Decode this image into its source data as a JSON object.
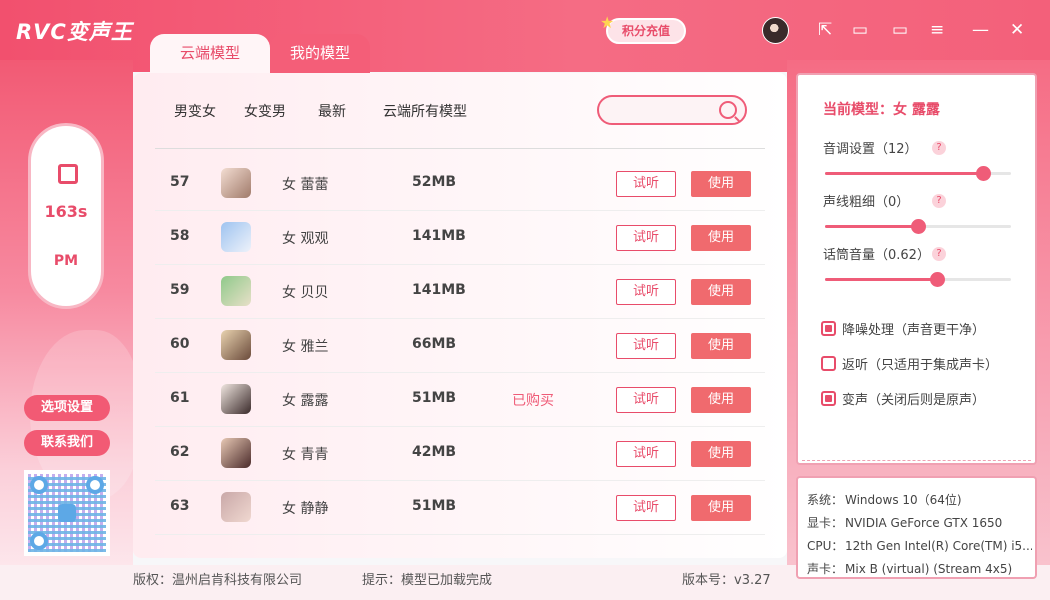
{
  "app": {
    "logo": "RVC变声王",
    "recharge": "积分充值"
  },
  "window_controls": {
    "edit": "⇱",
    "screen": "▭",
    "chat": "▭",
    "menu": "≡",
    "min": "—",
    "close": "✕"
  },
  "tabs": [
    "云端模型",
    "我的模型"
  ],
  "categories": [
    "男变女",
    "女变男",
    "最新",
    "云端所有模型"
  ],
  "search": {
    "placeholder": "",
    "value": ""
  },
  "models": [
    {
      "num": "57",
      "name": "女 蕾蕾",
      "size": "52MB",
      "status": "",
      "try": "试听",
      "use": "使用"
    },
    {
      "num": "58",
      "name": "女 观观",
      "size": "141MB",
      "status": "",
      "try": "试听",
      "use": "使用"
    },
    {
      "num": "59",
      "name": "女 贝贝",
      "size": "141MB",
      "status": "",
      "try": "试听",
      "use": "使用"
    },
    {
      "num": "60",
      "name": "女 雅兰",
      "size": "66MB",
      "status": "",
      "try": "试听",
      "use": "使用"
    },
    {
      "num": "61",
      "name": "女 露露",
      "size": "51MB",
      "status": "已购买",
      "try": "试听",
      "use": "使用"
    },
    {
      "num": "62",
      "name": "女 青青",
      "size": "42MB",
      "status": "",
      "try": "试听",
      "use": "使用"
    },
    {
      "num": "63",
      "name": "女 静静",
      "size": "51MB",
      "status": "",
      "try": "试听",
      "use": "使用"
    }
  ],
  "record": {
    "time": "163s",
    "period": "PM"
  },
  "left_buttons": {
    "settings": "选项设置",
    "contact": "联系我们"
  },
  "current_model": "当前模型：女 露露",
  "settings": [
    {
      "label": "音调设置（12）",
      "help": "?",
      "fraction": 0.85
    },
    {
      "label": "声线粗细（0）",
      "help": "?",
      "fraction": 0.5
    },
    {
      "label": "话筒音量（0.62）",
      "help": "?",
      "fraction": 0.6
    }
  ],
  "checkboxes": [
    {
      "label": "降噪处理（声音更干净）",
      "checked": true
    },
    {
      "label": "返听（只适用于集成声卡）",
      "checked": false
    },
    {
      "label": "变声（关闭后则是原声）",
      "checked": true
    }
  ],
  "system": [
    {
      "k": "系统：",
      "v": "Windows 10（64位)"
    },
    {
      "k": "显卡：",
      "v": "NVIDIA GeForce GTX 1650"
    },
    {
      "k": "CPU：",
      "v": "12th Gen Intel(R) Core(TM) i5..."
    },
    {
      "k": "声卡：",
      "v": "Mix B (virtual) (Stream 4x5)"
    }
  ],
  "footer": {
    "copyright": "版权：温州启肯科技有限公司",
    "hint": "提示：模型已加载完成",
    "version": "版本号：v3.27"
  },
  "colors": {
    "accent": "#e84c6a",
    "use_button": "#f06a6e"
  }
}
